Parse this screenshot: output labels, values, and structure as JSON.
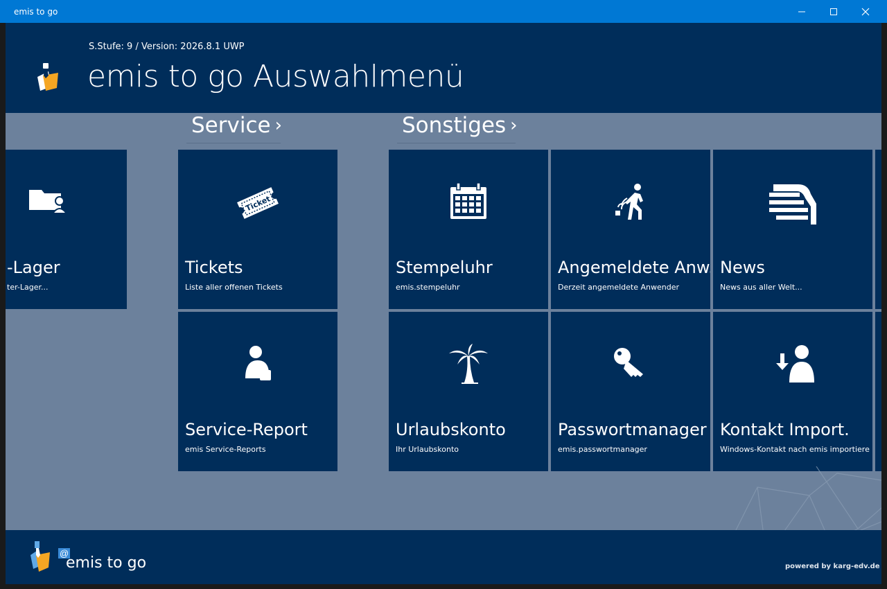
{
  "window": {
    "title": "emis to go"
  },
  "header": {
    "version": "S.Stufe: 9 / Version: 2026.8.1 UWP",
    "title": "emis to go Auswahlmenü"
  },
  "groups": [
    {
      "name": "Service"
    },
    {
      "name": "Sonstiges"
    }
  ],
  "chevron": "›",
  "tiles": {
    "lager": {
      "title": "-Lager",
      "subtitle": "ter-Lager...",
      "icon": "folder-user-icon"
    },
    "tickets": {
      "title": "Tickets",
      "subtitle": "Liste aller offenen Tickets",
      "icon": "ticket-icon",
      "ticket_text": "Ticket"
    },
    "service_report": {
      "title": "Service-Report",
      "subtitle": "emis Service-Reports",
      "icon": "user-report-icon"
    },
    "stempeluhr": {
      "title": "Stempeluhr",
      "subtitle": "emis.stempeluhr",
      "icon": "calendar-icon"
    },
    "angemeldete": {
      "title": "Angemeldete Anw.",
      "subtitle": "Derzeit angemeldete Anwender",
      "icon": "walking-user-icon"
    },
    "news": {
      "title": "News",
      "subtitle": "News aus aller Welt...",
      "icon": "news-icon"
    },
    "urlaubskonto": {
      "title": "Urlaubskonto",
      "subtitle": "Ihr Urlaubskonto",
      "icon": "palm-tree-icon"
    },
    "passwortmanager": {
      "title": "Passwortmanager",
      "subtitle": "emis.passwortmanager",
      "icon": "key-icon"
    },
    "kontakt": {
      "title": "Kontakt Import.",
      "subtitle": "Windows-Kontakt nach emis importiere",
      "icon": "contact-import-icon"
    }
  },
  "footer": {
    "at": "@",
    "brand": "emis to go",
    "powered": "powered by karg-edv.de"
  },
  "colors": {
    "titlebar": "#0078d4",
    "panel": "#002d5a",
    "background": "#6c819c",
    "logo_orange": "#f5a623",
    "logo_blue": "#5fa8e6"
  }
}
